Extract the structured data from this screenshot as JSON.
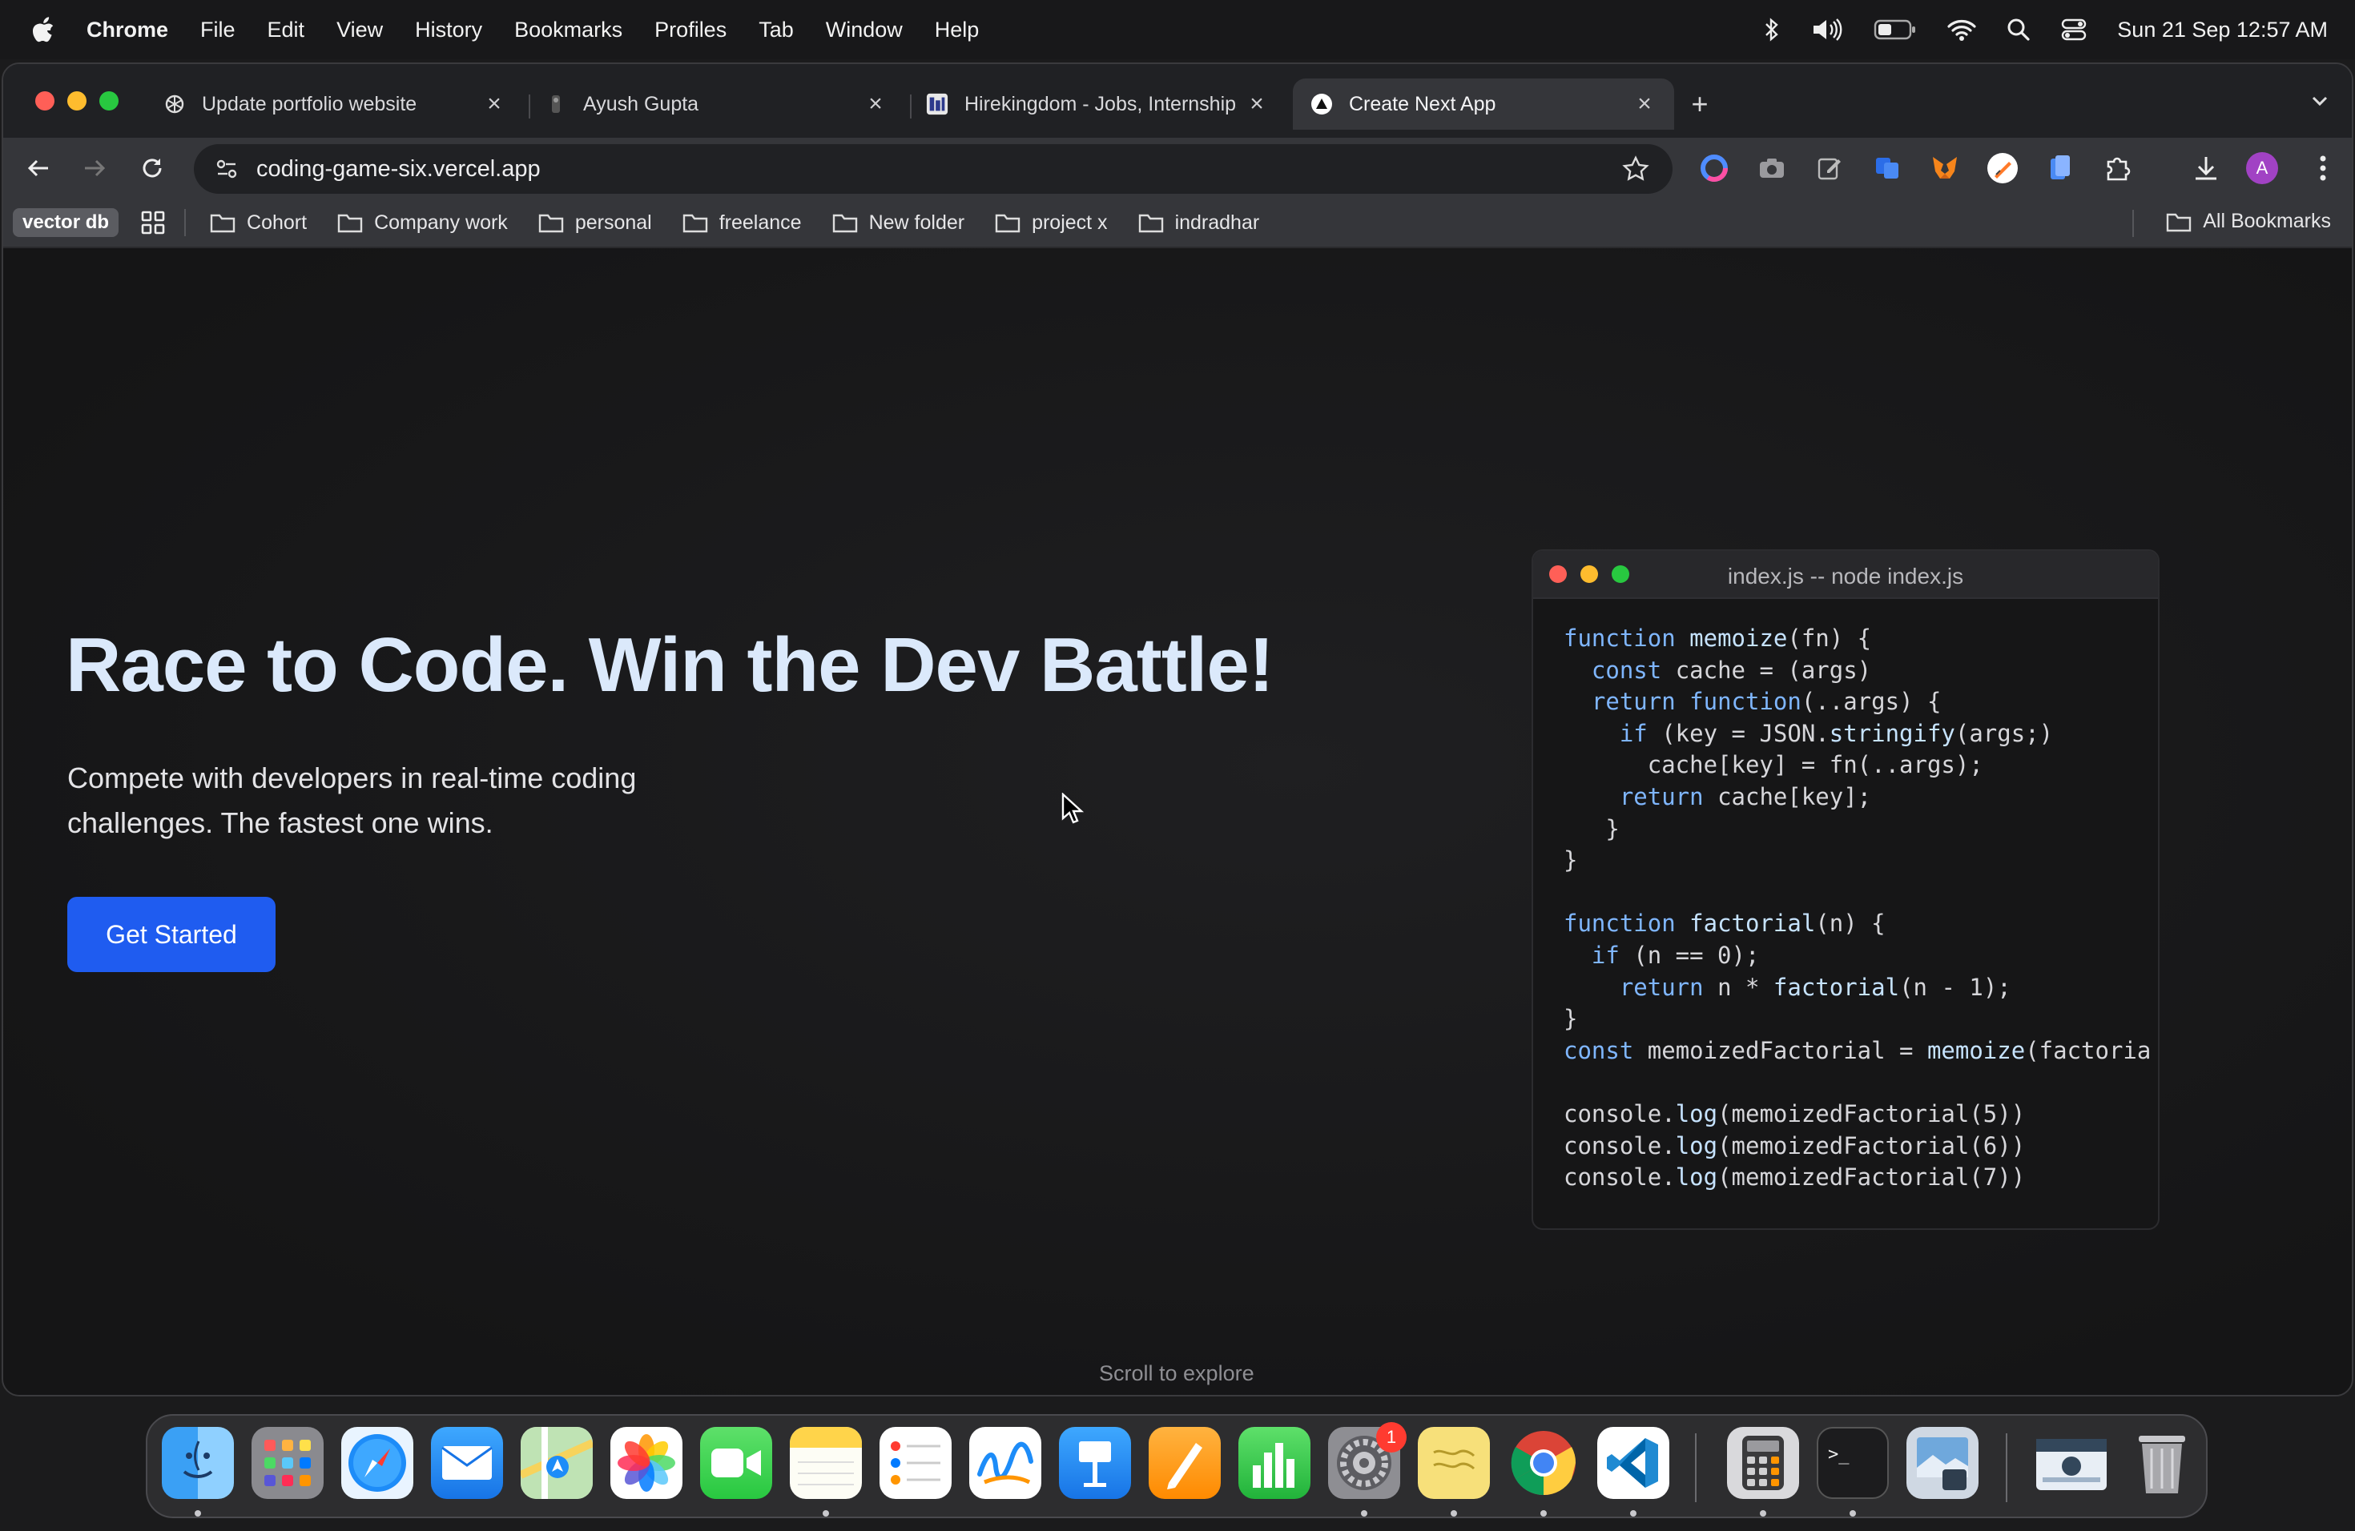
{
  "menubar": {
    "items": [
      "Chrome",
      "File",
      "Edit",
      "View",
      "History",
      "Bookmarks",
      "Profiles",
      "Tab",
      "Window",
      "Help"
    ],
    "clock": "Sun 21 Sep  12:57 AM"
  },
  "tabs": [
    {
      "title": "Update portfolio website",
      "icon": "openai-icon"
    },
    {
      "title": "Ayush Gupta",
      "icon": "profile-icon"
    },
    {
      "title": "Hirekingdom - Jobs, Internships",
      "icon": "hirekingdom-icon"
    },
    {
      "title": "Create Next App",
      "icon": "nextjs-icon",
      "active": true
    }
  ],
  "omnibox": {
    "url": "coding-game-six.vercel.app"
  },
  "bookmarks": {
    "chip": "vector db",
    "folders": [
      "Cohort",
      "Company work",
      "personal",
      "freelance",
      "New folder",
      "project x",
      "indradhar"
    ],
    "all": "All Bookmarks"
  },
  "hero": {
    "title": "Race to Code. Win the Dev Battle!",
    "subtitle_line1": "Compete with developers in real-time coding",
    "subtitle_line2": "challenges. The fastest one wins.",
    "cta": "Get Started"
  },
  "code_window": {
    "title": "index.js -- node index.js",
    "lines": [
      "function memoize(fn) {",
      "  const cache = (args)",
      "  return function(..args) {",
      "    if (key = JSON.stringify(args;)",
      "      cache[key] = fn(..args);",
      "    return cache[key];",
      "   }",
      "}",
      "",
      "function factorial(n) {",
      "  if (n == 0);",
      "    return n * factorial(n - 1);",
      "}",
      "const memoizedFactorial = memoize(factoria",
      "",
      "console.log(memoizedFactorial(5))",
      "console.log(memoizedFactorial(6))",
      "console.log(memoizedFactorial(7))"
    ]
  },
  "scroll_hint": "Scroll to explore",
  "dock": {
    "apps": [
      "Finder",
      "Launchpad",
      "Safari",
      "Mail",
      "Maps",
      "Photos",
      "FaceTime",
      "Notes",
      "Reminders",
      "Freeform",
      "Keynote",
      "Pages",
      "Numbers",
      "System Settings",
      "Stickies",
      "Google Chrome",
      "Visual Studio Code",
      "Calculator",
      "Terminal",
      "Preview",
      "Downloads",
      "Trash"
    ],
    "settings_badge": "1"
  },
  "colors": {
    "accent": "#1f5cf0",
    "hero_title": "#dbe9fb",
    "code_keyword": "#7fb6ff"
  }
}
